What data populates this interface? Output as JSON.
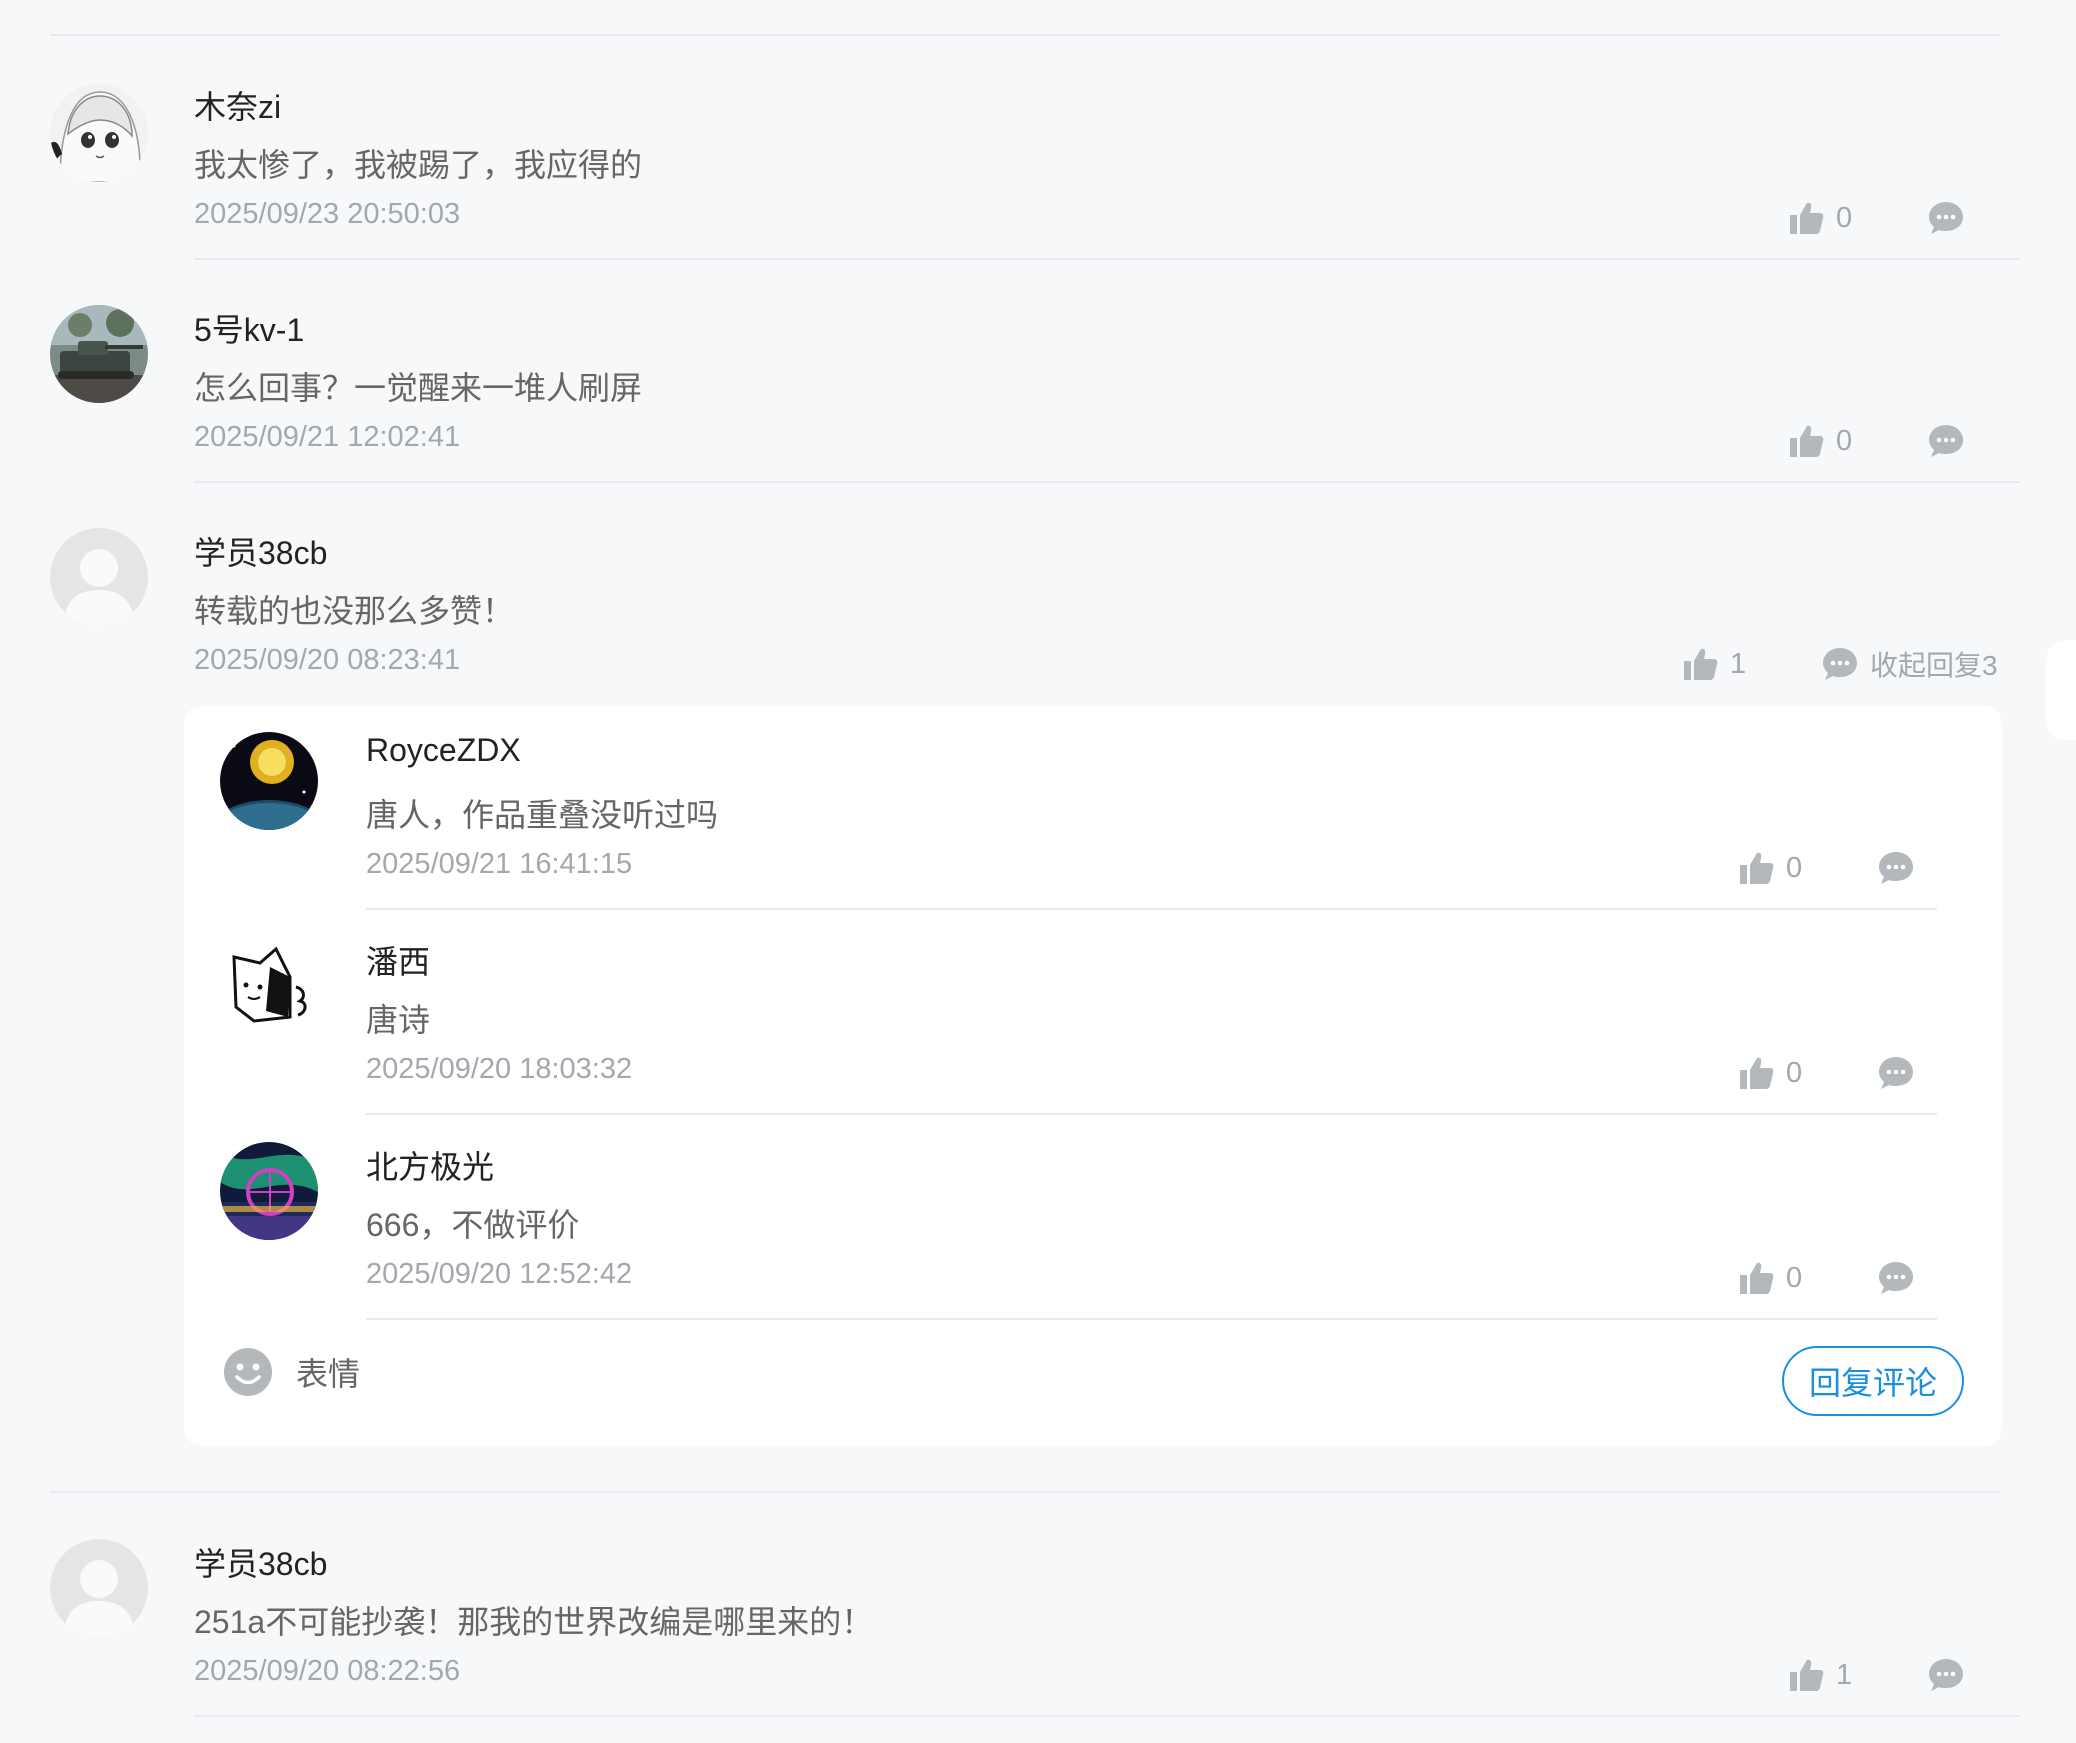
{
  "comments": [
    {
      "name": "木奈zi",
      "text": "我太惨了，我被踢了，我应得的",
      "time": "2025/09/23 20:50:03",
      "likes": "0",
      "avatar": "anime-girl-avatar"
    },
    {
      "name": "5号kv-1",
      "text": "怎么回事？一觉醒来一堆人刷屏",
      "time": "2025/09/21 12:02:41",
      "likes": "0",
      "avatar": "tank-avatar"
    },
    {
      "name": "学员38cb",
      "text": "转载的也没那么多赞！",
      "time": "2025/09/20 08:23:41",
      "likes": "1",
      "reply_toggle": "收起回复3",
      "avatar": "default-user-avatar",
      "replies": [
        {
          "name": "RoyceZDX",
          "text": "唐人，作品重叠没听过吗",
          "time": "2025/09/21 16:41:15",
          "likes": "0",
          "avatar": "planet-avatar"
        },
        {
          "name": "潘西",
          "text": "唐诗",
          "time": "2025/09/20 18:03:32",
          "likes": "0",
          "avatar": "sketch-character-avatar"
        },
        {
          "name": "北方极光",
          "text": "666，不做评价",
          "time": "2025/09/20 12:52:42",
          "likes": "0",
          "avatar": "ferris-wheel-aurora-avatar"
        }
      ],
      "composer": {
        "emoji_label": "表情",
        "submit_label": "回复评论"
      }
    },
    {
      "name": "学员38cb",
      "text": "251a不可能抄袭！那我的世界改编是哪里来的！",
      "time": "2025/09/20 08:22:56",
      "likes": "1",
      "avatar": "default-user-avatar"
    }
  ],
  "icons": {
    "like": "thumbs-up-icon",
    "reply": "chat-bubble-icon",
    "emoji": "smiley-face-icon"
  },
  "colors": {
    "accent": "#1a8fe0",
    "icon_gray": "#a3a8ae",
    "background": "#f7f8fa"
  }
}
